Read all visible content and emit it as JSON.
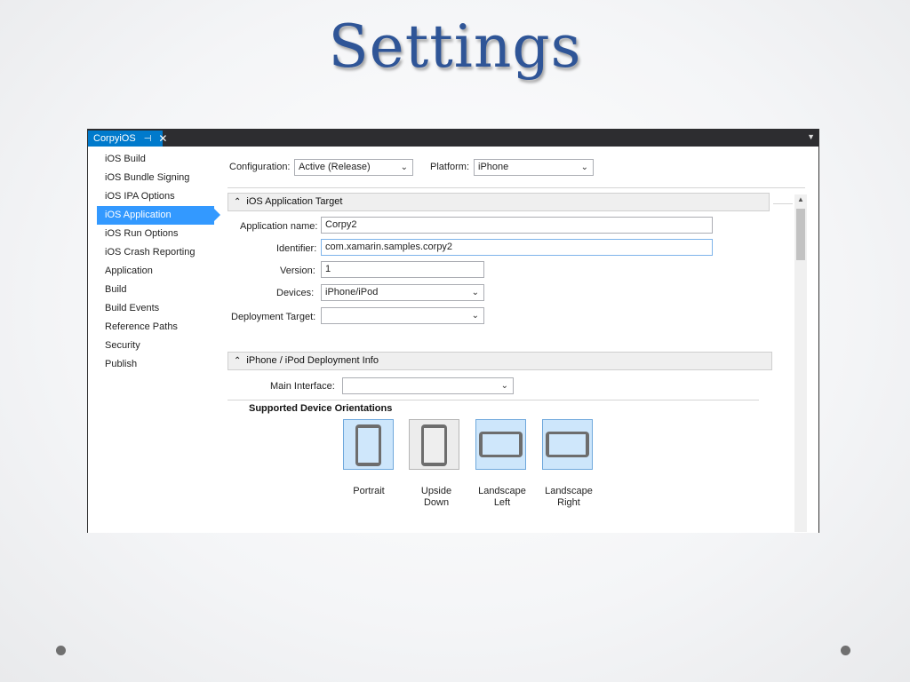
{
  "slide": {
    "title": "Settings"
  },
  "window": {
    "tab_title": "CorpyiOS",
    "tab_pin_icon": "pin-icon",
    "tab_close_icon": "close-icon",
    "tab_menu_icon": "dropdown-triangle-icon"
  },
  "nav": {
    "items": [
      {
        "label": "iOS Build"
      },
      {
        "label": "iOS Bundle Signing"
      },
      {
        "label": "iOS IPA Options"
      },
      {
        "label": "iOS Application",
        "selected": true
      },
      {
        "label": "iOS Run Options"
      },
      {
        "label": "iOS Crash Reporting"
      },
      {
        "label": "Application"
      },
      {
        "label": "Build"
      },
      {
        "label": "Build Events"
      },
      {
        "label": "Reference Paths"
      },
      {
        "label": "Security"
      },
      {
        "label": "Publish"
      }
    ]
  },
  "config": {
    "configuration_label": "Configuration:",
    "configuration_value": "Active (Release)",
    "platform_label": "Platform:",
    "platform_value": "iPhone"
  },
  "app_target": {
    "header": "iOS Application Target",
    "app_name_label": "Application name:",
    "app_name_value": "Corpy2",
    "identifier_label": "Identifier:",
    "identifier_value": "com.xamarin.samples.corpy2",
    "version_label": "Version:",
    "version_value": "1",
    "devices_label": "Devices:",
    "devices_value": "iPhone/iPod",
    "deployment_target_label": "Deployment Target:",
    "deployment_target_value": ""
  },
  "deployment_info": {
    "header": "iPhone / iPod Deployment Info",
    "main_interface_label": "Main Interface:",
    "main_interface_value": "",
    "orientations_title": "Supported Device Orientations",
    "orientations": [
      {
        "label_line1": "Portrait",
        "label_line2": "",
        "selected": true
      },
      {
        "label_line1": "Upside",
        "label_line2": "Down",
        "selected": false
      },
      {
        "label_line1": "Landscape",
        "label_line2": "Left",
        "selected": true
      },
      {
        "label_line1": "Landscape",
        "label_line2": "Right",
        "selected": true
      }
    ]
  },
  "colors": {
    "title": "#2f5597",
    "tab_active": "#007acc",
    "nav_selected": "#3399ff",
    "orientation_selected_bg": "#cde6fb"
  }
}
